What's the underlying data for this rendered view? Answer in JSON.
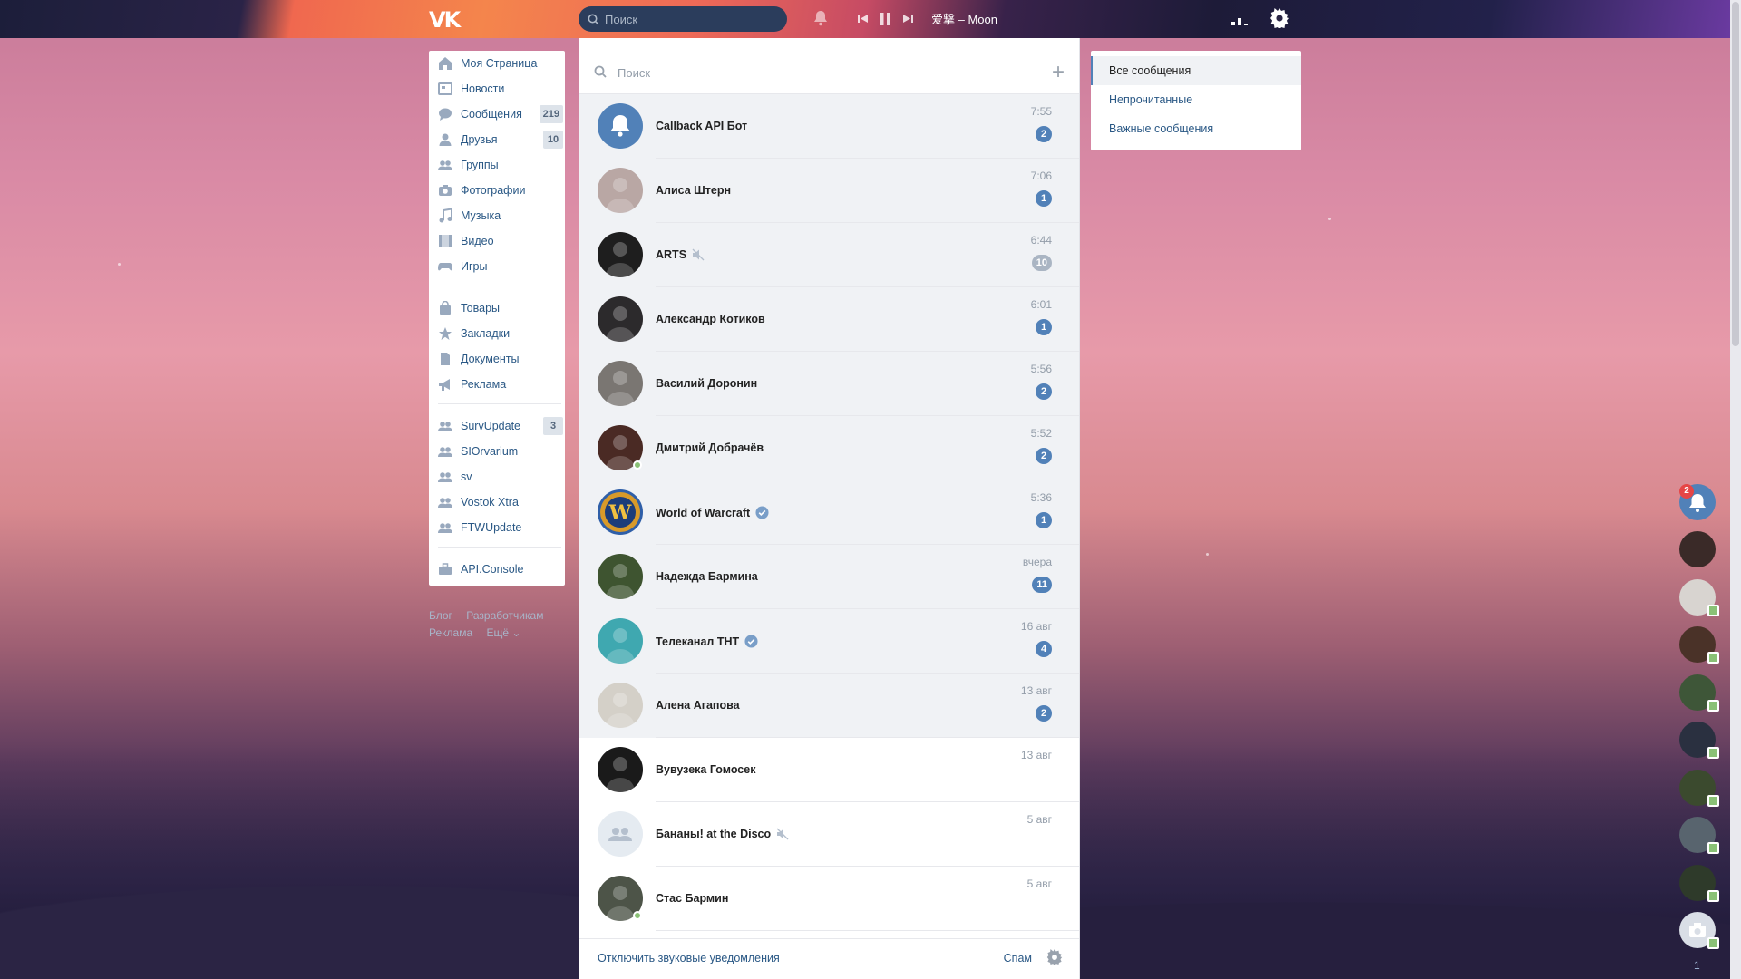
{
  "topbar": {
    "logo": "VK",
    "search_placeholder": "Поиск",
    "track": "爱撃 – Moon"
  },
  "nav": [
    {
      "label": "Моя Страница",
      "icon": "home-icon"
    },
    {
      "label": "Новости",
      "icon": "news-icon"
    },
    {
      "label": "Сообщения",
      "icon": "message-icon",
      "count": "219"
    },
    {
      "label": "Друзья",
      "icon": "friend-icon",
      "count": "10"
    },
    {
      "label": "Группы",
      "icon": "group-icon"
    },
    {
      "label": "Фотографии",
      "icon": "camera-icon"
    },
    {
      "label": "Музыка",
      "icon": "music-icon"
    },
    {
      "label": "Видео",
      "icon": "video-icon"
    },
    {
      "label": "Игры",
      "icon": "gamepad-icon"
    },
    {
      "label": "Товары",
      "icon": "bag-icon"
    },
    {
      "label": "Закладки",
      "icon": "star-icon"
    },
    {
      "label": "Документы",
      "icon": "document-icon"
    },
    {
      "label": "Реклама",
      "icon": "megaphone-icon"
    },
    {
      "label": "SurvUpdate",
      "icon": "group-icon",
      "count": "3"
    },
    {
      "label": "SIOrvarium",
      "icon": "group-icon"
    },
    {
      "label": "sv",
      "icon": "group-icon"
    },
    {
      "label": "Vostok Xtra",
      "icon": "group-icon"
    },
    {
      "label": "FTWUpdate",
      "icon": "group-icon"
    },
    {
      "label": "API.Console",
      "icon": "briefcase-icon"
    }
  ],
  "footer_links": {
    "blog": "Блог",
    "developers": "Разработчикам",
    "ads": "Реклама",
    "more": "Ещё ⌄"
  },
  "messages": {
    "search_placeholder": "Поиск",
    "plus": "+",
    "dialogs": [
      {
        "name": "Callback API Бот",
        "time": "7:55",
        "unread": "2",
        "muted": false,
        "verified": false,
        "online": false,
        "avatar_color": "#5181b8",
        "unread_row": true
      },
      {
        "name": "Алиса Штерн",
        "time": "7:06",
        "unread": "1",
        "muted": false,
        "verified": false,
        "online": false,
        "avatar_color": "#b9a7a4",
        "unread_row": true
      },
      {
        "name": "ARTS",
        "time": "6:44",
        "unread": "10",
        "muted": true,
        "verified": false,
        "online": false,
        "avatar_color": "#1e1e1e",
        "unread_row": true
      },
      {
        "name": "Александр Котиков",
        "time": "6:01",
        "unread": "1",
        "muted": false,
        "verified": false,
        "online": false,
        "avatar_color": "#2c2a2c",
        "unread_row": true
      },
      {
        "name": "Василий Доронин",
        "time": "5:56",
        "unread": "2",
        "muted": false,
        "verified": false,
        "online": false,
        "avatar_color": "#7a7672",
        "unread_row": true
      },
      {
        "name": "Дмитрий Добрачёв",
        "time": "5:52",
        "unread": "2",
        "muted": false,
        "verified": false,
        "online": true,
        "avatar_color": "#4a2a24",
        "unread_row": true
      },
      {
        "name": "World of Warcraft",
        "time": "5:36",
        "unread": "1",
        "muted": false,
        "verified": true,
        "online": false,
        "avatar_color": "#2f5fa8",
        "unread_row": true
      },
      {
        "name": "Надежда Бармина",
        "time": "вчера",
        "unread": "11",
        "muted": false,
        "verified": false,
        "online": false,
        "avatar_color": "#3e5430",
        "unread_row": true
      },
      {
        "name": "Телеканал ТНТ",
        "time": "16 авг",
        "unread": "4",
        "muted": false,
        "verified": true,
        "online": false,
        "avatar_color": "#3fa8b0",
        "unread_row": true
      },
      {
        "name": "Алена Агапова",
        "time": "13 авг",
        "unread": "2",
        "muted": false,
        "verified": false,
        "online": false,
        "avatar_color": "#d4d0c8",
        "unread_row": true
      },
      {
        "name": "Вувузека Гомосек",
        "time": "13 авг",
        "unread": "",
        "muted": false,
        "verified": false,
        "online": false,
        "avatar_color": "#1a1a1a",
        "unread_row": false
      },
      {
        "name": "Бананы! at the Disco",
        "time": "5 авг",
        "unread": "",
        "muted": true,
        "verified": false,
        "online": false,
        "avatar_color": "#e5ebf1",
        "unread_row": false
      },
      {
        "name": "Стас Бармин",
        "time": "5 авг",
        "unread": "",
        "muted": false,
        "verified": false,
        "online": true,
        "avatar_color": "#4d5448",
        "unread_row": false
      }
    ],
    "footer": {
      "mute_label": "Отключить звуковые уведомления",
      "spam_label": "Спам"
    }
  },
  "filters": {
    "items": [
      "Все сообщения",
      "Непрочитанные",
      "Важные сообщения"
    ]
  },
  "side": {
    "notification_count": "2",
    "bottom_count": "1",
    "avatars": [
      "#3a2a28",
      "#d8d4d0",
      "#4a3228",
      "#3e5638",
      "#2a3040",
      "#3b4a2e",
      "#58646e",
      "#2e3a2a"
    ]
  },
  "colors": {
    "accent": "#5181b8",
    "link": "#2a5885",
    "online": "#8ac176",
    "unread_bg": "#f0f2f5"
  }
}
